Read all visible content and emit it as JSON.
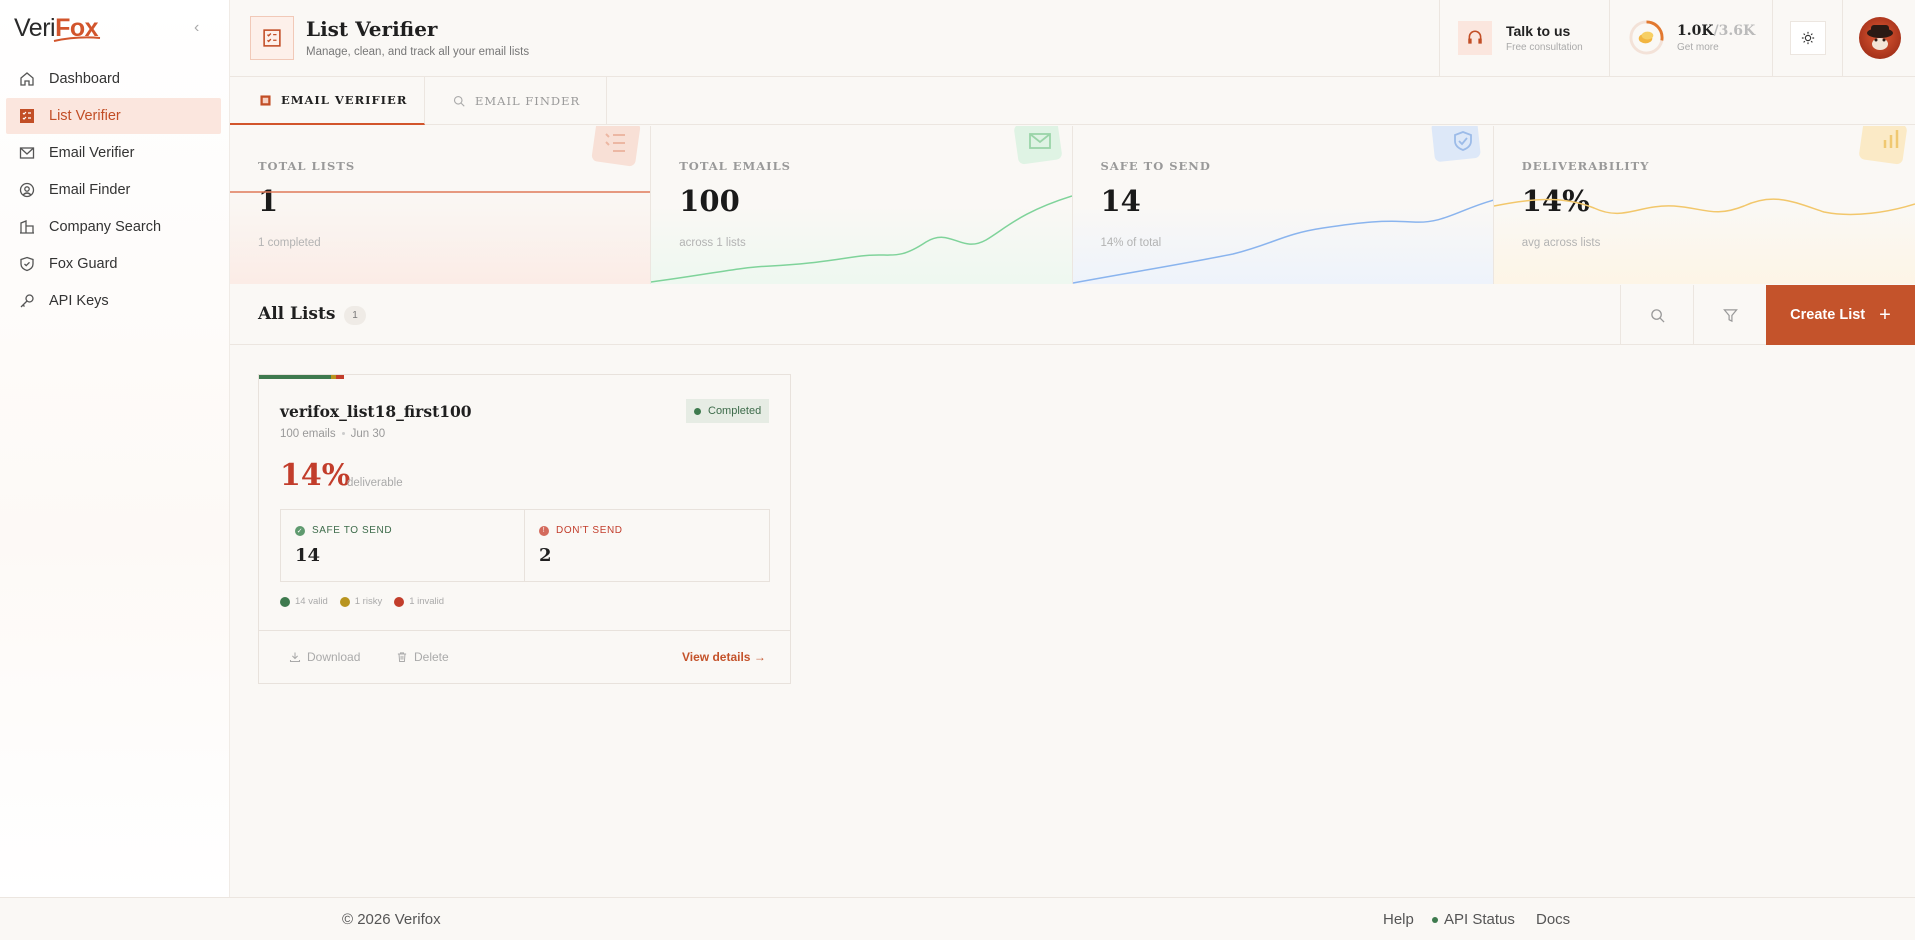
{
  "app": {
    "logo_left": "Veri",
    "logo_right": "Fox"
  },
  "sidebar": {
    "items": [
      {
        "label": "Dashboard",
        "icon": "home-icon"
      },
      {
        "label": "List Verifier",
        "icon": "list-check-icon",
        "active": true
      },
      {
        "label": "Email Verifier",
        "icon": "mail-icon"
      },
      {
        "label": "Email Finder",
        "icon": "user-search-icon"
      },
      {
        "label": "Company Search",
        "icon": "building-icon"
      },
      {
        "label": "Fox Guard",
        "icon": "shield-icon"
      },
      {
        "label": "API Keys",
        "icon": "key-icon"
      }
    ]
  },
  "header": {
    "title": "List Verifier",
    "subtitle": "Manage, clean, and track all your email lists",
    "talk_title": "Talk to us",
    "talk_sub": "Free consultation",
    "credits_used": "1.0K",
    "credits_total": "/3.6K",
    "credits_sub": "Get more",
    "credits_fraction": 0.28
  },
  "tabs": [
    {
      "label": "EMAIL VERIFIER",
      "active": true
    },
    {
      "label": "EMAIL FINDER",
      "active": false
    }
  ],
  "stats": [
    {
      "label": "TOTAL LISTS",
      "value": "1",
      "sub": "1 completed",
      "color": "#e07a5a"
    },
    {
      "label": "TOTAL EMAILS",
      "value": "100",
      "sub": "across 1 lists",
      "color": "#7fd39a"
    },
    {
      "label": "SAFE TO SEND",
      "value": "14",
      "sub": "14% of total",
      "color": "#8ab4ee"
    },
    {
      "label": "DELIVERABILITY",
      "value": "14%",
      "sub": "avg across lists",
      "color": "#f2c76b"
    }
  ],
  "toolbar": {
    "title": "All Lists",
    "count": "1",
    "create_label": "Create List",
    "create_plus": "+"
  },
  "card": {
    "name": "verifox_list18_first100",
    "emails": "100 emails",
    "date": "Jun 30",
    "status": "Completed",
    "pct": "14%",
    "pct_label": "deliverable",
    "safe_label": "SAFE TO SEND",
    "safe_value": "14",
    "dont_label": "DON'T SEND",
    "dont_value": "2",
    "legend_valid": "14 valid",
    "legend_risky": "1 risky",
    "legend_invalid": "1 invalid",
    "download": "Download",
    "delete": "Delete",
    "view": "View details →",
    "colors": {
      "valid": "#3e7a4e",
      "risky": "#b8941f",
      "invalid": "#c23d2b"
    }
  },
  "footer": {
    "copyright": "© 2026 Verifox",
    "help": "Help",
    "api_status": "API Status",
    "docs": "Docs"
  }
}
